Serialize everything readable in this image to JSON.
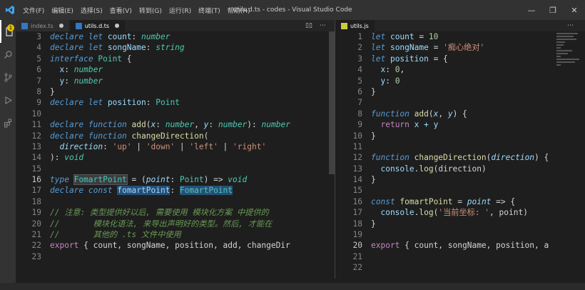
{
  "window": {
    "title": "utils.d.ts - codes - Visual Studio Code",
    "menu": [
      "文件(F)",
      "编辑(E)",
      "选择(S)",
      "查看(V)",
      "转到(G)",
      "运行(R)",
      "终端(T)",
      "帮助(H)"
    ],
    "controls": [
      "—",
      "❐",
      "✕"
    ]
  },
  "activity": {
    "badge": "1"
  },
  "left_tabs": [
    {
      "label": "index.ts"
    },
    {
      "label": "utils.d.ts"
    }
  ],
  "right_tabs": [
    {
      "label": "utils.js"
    }
  ],
  "left_editor": {
    "current_line": "16",
    "lines": [
      {
        "n": "3",
        "toks": [
          [
            "declare",
            "k"
          ],
          [
            " ",
            "w"
          ],
          [
            "let",
            "k"
          ],
          [
            " count",
            "v"
          ],
          [
            ": ",
            "w"
          ],
          [
            "number",
            "ti"
          ]
        ]
      },
      {
        "n": "4",
        "toks": [
          [
            "declare",
            "k"
          ],
          [
            " ",
            "w"
          ],
          [
            "let",
            "k"
          ],
          [
            " songName",
            "v"
          ],
          [
            ": ",
            "w"
          ],
          [
            "string",
            "ti"
          ]
        ]
      },
      {
        "n": "5",
        "toks": [
          [
            "interface",
            "k"
          ],
          [
            " Point",
            "t"
          ],
          [
            " {",
            "w"
          ]
        ]
      },
      {
        "n": "6",
        "toks": [
          [
            "  x",
            "v"
          ],
          [
            ": ",
            "w"
          ],
          [
            "number",
            "ti"
          ]
        ]
      },
      {
        "n": "7",
        "toks": [
          [
            "  y",
            "v"
          ],
          [
            ": ",
            "w"
          ],
          [
            "number",
            "ti"
          ]
        ]
      },
      {
        "n": "8",
        "toks": [
          [
            "}",
            "w"
          ]
        ]
      },
      {
        "n": "9",
        "toks": [
          [
            "declare",
            "k"
          ],
          [
            " ",
            "w"
          ],
          [
            "let",
            "k"
          ],
          [
            " position",
            "v"
          ],
          [
            ": ",
            "w"
          ],
          [
            "Point",
            "t"
          ]
        ]
      },
      {
        "n": "10",
        "toks": []
      },
      {
        "n": "11",
        "toks": [
          [
            "declare",
            "k"
          ],
          [
            " ",
            "w"
          ],
          [
            "function",
            "k"
          ],
          [
            " add",
            "f"
          ],
          [
            "(",
            "w"
          ],
          [
            "x",
            "p"
          ],
          [
            ": ",
            "w"
          ],
          [
            "number",
            "ti"
          ],
          [
            ", ",
            "w"
          ],
          [
            "y",
            "p"
          ],
          [
            ": ",
            "w"
          ],
          [
            "number",
            "ti"
          ],
          [
            "): ",
            "w"
          ],
          [
            "number",
            "ti"
          ]
        ]
      },
      {
        "n": "12",
        "toks": [
          [
            "declare",
            "k"
          ],
          [
            " ",
            "w"
          ],
          [
            "function",
            "k"
          ],
          [
            " changeDirection",
            "f"
          ],
          [
            "(",
            "w"
          ]
        ]
      },
      {
        "n": "13",
        "toks": [
          [
            "  direction",
            "p"
          ],
          [
            ": ",
            "w"
          ],
          [
            "'up'",
            "s"
          ],
          [
            " | ",
            "w"
          ],
          [
            "'down'",
            "s"
          ],
          [
            " | ",
            "w"
          ],
          [
            "'left'",
            "s"
          ],
          [
            " | ",
            "w"
          ],
          [
            "'right'",
            "s"
          ]
        ]
      },
      {
        "n": "14",
        "toks": [
          [
            "): ",
            "w"
          ],
          [
            "void",
            "ti"
          ]
        ]
      },
      {
        "n": "15",
        "toks": []
      },
      {
        "n": "16",
        "toks": [
          [
            "type",
            "k"
          ],
          [
            " ",
            "w"
          ],
          [
            "FomartPoint",
            "t hl2"
          ],
          [
            " = (",
            "w"
          ],
          [
            "point",
            "p"
          ],
          [
            ": ",
            "w"
          ],
          [
            "Point",
            "t"
          ],
          [
            ") => ",
            "w"
          ],
          [
            "void",
            "ti"
          ]
        ]
      },
      {
        "n": "17",
        "toks": [
          [
            "declare",
            "k"
          ],
          [
            " ",
            "w"
          ],
          [
            "const",
            "k"
          ],
          [
            " ",
            "w"
          ],
          [
            "fomartPoint",
            "v hl"
          ],
          [
            ": ",
            "w"
          ],
          [
            "FomartPoint",
            "t hl"
          ]
        ]
      },
      {
        "n": "18",
        "toks": []
      },
      {
        "n": "19",
        "toks": [
          [
            "// 注意: 类型提供好以后, 需要使用 模块化方案 中提供的",
            "c"
          ]
        ]
      },
      {
        "n": "20",
        "toks": [
          [
            "//       模块化语法, 来导出声明好的类型。然后, 才能在",
            "c"
          ]
        ]
      },
      {
        "n": "21",
        "toks": [
          [
            "//       其他的 .ts 文件中使用",
            "c"
          ]
        ]
      },
      {
        "n": "22",
        "toks": [
          [
            "export",
            "kn"
          ],
          [
            " { count, songName, position, add, changeDir",
            "w"
          ]
        ]
      },
      {
        "n": "23",
        "toks": []
      }
    ]
  },
  "right_editor": {
    "current_line": "20",
    "lines": [
      {
        "n": "1",
        "toks": [
          [
            "let",
            "k"
          ],
          [
            " count",
            "v"
          ],
          [
            " = ",
            "w"
          ],
          [
            "10",
            "n"
          ]
        ]
      },
      {
        "n": "2",
        "toks": [
          [
            "let",
            "k"
          ],
          [
            " songName",
            "v"
          ],
          [
            " = ",
            "w"
          ],
          [
            "'痴心绝对'",
            "s"
          ]
        ]
      },
      {
        "n": "3",
        "toks": [
          [
            "let",
            "k"
          ],
          [
            " position",
            "v"
          ],
          [
            " = {",
            "w"
          ]
        ]
      },
      {
        "n": "4",
        "toks": [
          [
            "  x",
            "v"
          ],
          [
            ": ",
            "w"
          ],
          [
            "0",
            "n"
          ],
          [
            ",",
            "w"
          ]
        ]
      },
      {
        "n": "5",
        "toks": [
          [
            "  y",
            "v"
          ],
          [
            ": ",
            "w"
          ],
          [
            "0",
            "n"
          ]
        ]
      },
      {
        "n": "6",
        "toks": [
          [
            "}",
            "w"
          ]
        ]
      },
      {
        "n": "7",
        "toks": []
      },
      {
        "n": "8",
        "toks": [
          [
            "function",
            "k"
          ],
          [
            " add",
            "f"
          ],
          [
            "(",
            "w"
          ],
          [
            "x",
            "p"
          ],
          [
            ", ",
            "w"
          ],
          [
            "y",
            "p"
          ],
          [
            ") {",
            "w"
          ]
        ]
      },
      {
        "n": "9",
        "toks": [
          [
            "  ",
            "w"
          ],
          [
            "return",
            "kn"
          ],
          [
            " x + y",
            "v"
          ]
        ]
      },
      {
        "n": "10",
        "toks": [
          [
            "}",
            "w"
          ]
        ]
      },
      {
        "n": "11",
        "toks": []
      },
      {
        "n": "12",
        "toks": [
          [
            "function",
            "k"
          ],
          [
            " changeDirection",
            "f"
          ],
          [
            "(",
            "w"
          ],
          [
            "direction",
            "p"
          ],
          [
            ") {",
            "w"
          ]
        ]
      },
      {
        "n": "13",
        "toks": [
          [
            "  console",
            "v"
          ],
          [
            ".",
            "w"
          ],
          [
            "log",
            "f"
          ],
          [
            "(direction)",
            "w"
          ]
        ]
      },
      {
        "n": "14",
        "toks": [
          [
            "}",
            "w"
          ]
        ]
      },
      {
        "n": "15",
        "toks": []
      },
      {
        "n": "16",
        "toks": [
          [
            "const",
            "k"
          ],
          [
            " fomartPoint",
            "f"
          ],
          [
            " = ",
            "w"
          ],
          [
            "point",
            "p"
          ],
          [
            " => {",
            "w"
          ]
        ]
      },
      {
        "n": "17",
        "toks": [
          [
            "  console",
            "v"
          ],
          [
            ".",
            "w"
          ],
          [
            "log",
            "f"
          ],
          [
            "(",
            "w"
          ],
          [
            "'当前坐标: '",
            "s"
          ],
          [
            ", point)",
            "w"
          ]
        ]
      },
      {
        "n": "18",
        "toks": [
          [
            "}",
            "w"
          ]
        ]
      },
      {
        "n": "19",
        "toks": []
      },
      {
        "n": "20",
        "toks": [
          [
            "export",
            "kn"
          ],
          [
            " { count, songName, position, a",
            "w"
          ]
        ]
      },
      {
        "n": "21",
        "toks": []
      },
      {
        "n": "22",
        "toks": []
      }
    ]
  },
  "colors": {
    "editor_bg": "#1e1e1e",
    "titlebar_bg": "#323233",
    "keyword": "#569cd6",
    "type": "#4ec9b0",
    "string": "#ce9178",
    "comment": "#6a9955"
  }
}
